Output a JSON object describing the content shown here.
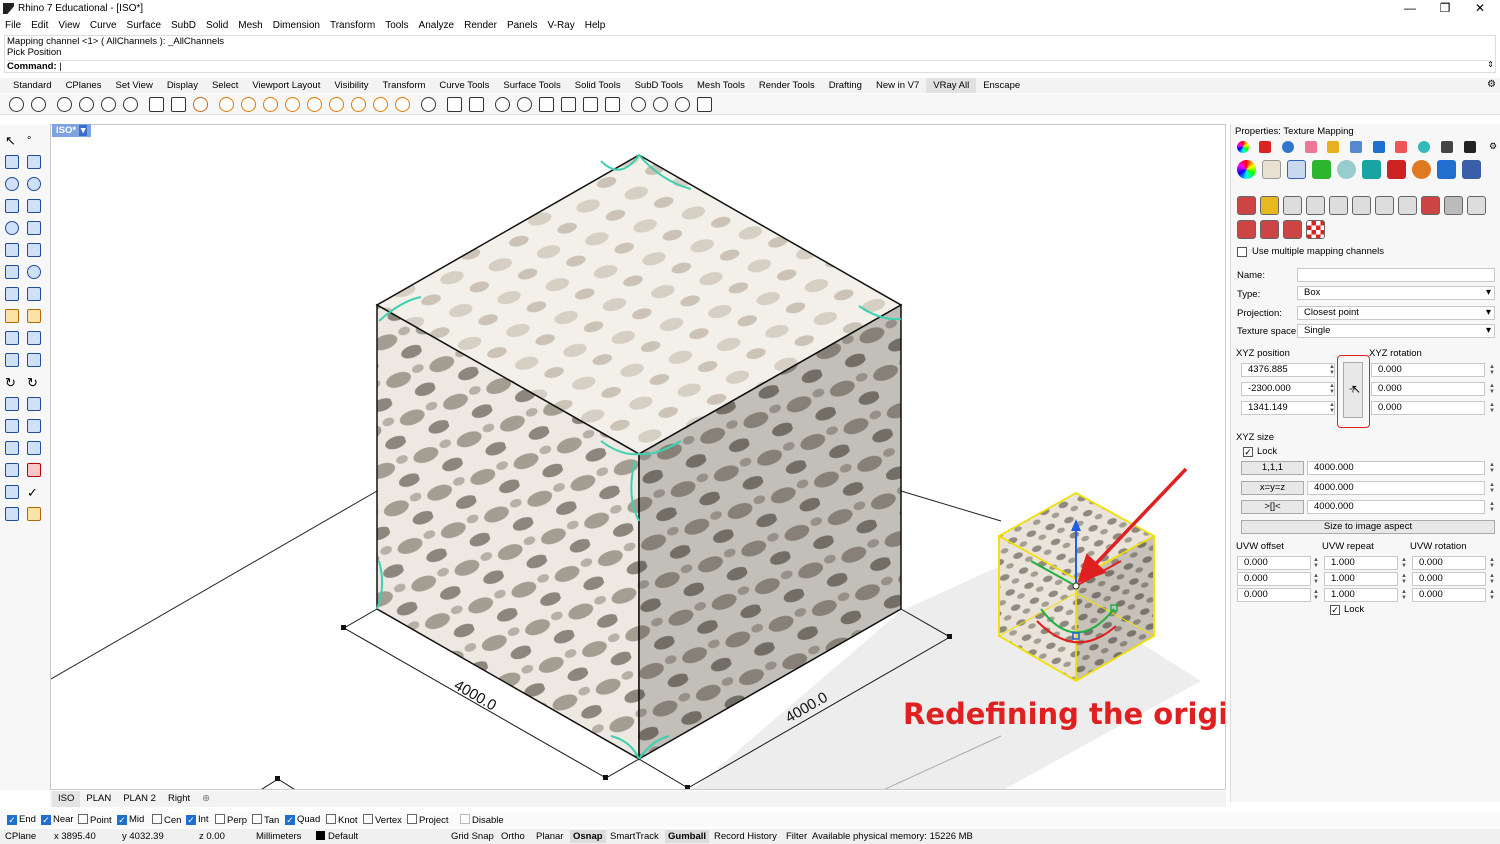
{
  "window": {
    "title": "Rhino 7 Educational - [ISO*]",
    "min": "—",
    "max": "❐",
    "close": "✕"
  },
  "menu": [
    "File",
    "Edit",
    "View",
    "Curve",
    "Surface",
    "SubD",
    "Solid",
    "Mesh",
    "Dimension",
    "Transform",
    "Tools",
    "Analyze",
    "Render",
    "Panels",
    "V-Ray",
    "Help"
  ],
  "command": {
    "history1": "Mapping channel <1> ( AllChannels ): _AllChannels",
    "history2": "Pick Position",
    "prompt": "Command:"
  },
  "toolbar_tabs": [
    "Standard",
    "CPlanes",
    "Set View",
    "Display",
    "Select",
    "Viewport Layout",
    "Visibility",
    "Transform",
    "Curve Tools",
    "Surface Tools",
    "Solid Tools",
    "SubD Tools",
    "Mesh Tools",
    "Render Tools",
    "Drafting",
    "New in V7",
    "VRay All",
    "Enscape"
  ],
  "toolbar_tabs_active": "VRay All",
  "viewport": {
    "label": "ISO*",
    "dim_left": "4000.0",
    "dim_right": "4000.0",
    "annotation": "Redefining the origin",
    "annotation_color": "#e02020",
    "tabs": [
      "ISO",
      "PLAN",
      "PLAN 2",
      "Right"
    ],
    "add_tab": "⊕"
  },
  "properties": {
    "title": "Properties: Texture Mapping",
    "use_multiple": "Use multiple mapping channels",
    "name_label": "Name:",
    "name_value": "",
    "type_label": "Type:",
    "type_value": "Box",
    "projection_label": "Projection:",
    "projection_value": "Closest point",
    "texture_space_label": "Texture space:",
    "texture_space_value": "Single",
    "xyz_position_label": "XYZ position",
    "xyz_rotation_label": "XYZ rotation",
    "position": [
      "4376.885",
      "-2300.000",
      "1341.149"
    ],
    "rotation": [
      "0.000",
      "0.000",
      "0.000"
    ],
    "xyz_size_label": "XYZ size",
    "lock_label": "Lock",
    "size_buttons": [
      "1,1,1",
      "x=y=z",
      ">[]<"
    ],
    "size": [
      "4000.000",
      "4000.000",
      "4000.000"
    ],
    "size_to_image": "Size to image aspect",
    "uvw_offset_label": "UVW offset",
    "uvw_repeat_label": "UVW repeat",
    "uvw_rotation_label": "UVW rotation",
    "uvw_offset": [
      "0.000",
      "0.000",
      "0.000"
    ],
    "uvw_repeat": [
      "1.000",
      "1.000",
      "1.000"
    ],
    "uvw_rotation": [
      "0.000",
      "0.000",
      "0.000"
    ],
    "uvw_lock_label": "Lock",
    "highlight_color": "#e02020"
  },
  "osnaps": [
    {
      "label": "End",
      "on": true
    },
    {
      "label": "Near",
      "on": true
    },
    {
      "label": "Point",
      "on": false
    },
    {
      "label": "Mid",
      "on": true
    },
    {
      "label": "Cen",
      "on": false
    },
    {
      "label": "Int",
      "on": true
    },
    {
      "label": "Perp",
      "on": false
    },
    {
      "label": "Tan",
      "on": false
    },
    {
      "label": "Quad",
      "on": true
    },
    {
      "label": "Knot",
      "on": false
    },
    {
      "label": "Vertex",
      "on": false
    },
    {
      "label": "Project",
      "on": false
    },
    {
      "label": "Disable",
      "on": false
    }
  ],
  "status": {
    "cplane": "CPlane",
    "x": "x 3895.40",
    "y": "y 4032.39",
    "z": "z 0.00",
    "units": "Millimeters",
    "layer": "Default",
    "grid_snap": "Grid Snap",
    "ortho": "Ortho",
    "planar": "Planar",
    "osnap": "Osnap",
    "smarttrack": "SmartTrack",
    "gumball": "Gumball",
    "record_history": "Record History",
    "filter": "Filter",
    "memory": "Available physical memory: 15226 MB"
  }
}
